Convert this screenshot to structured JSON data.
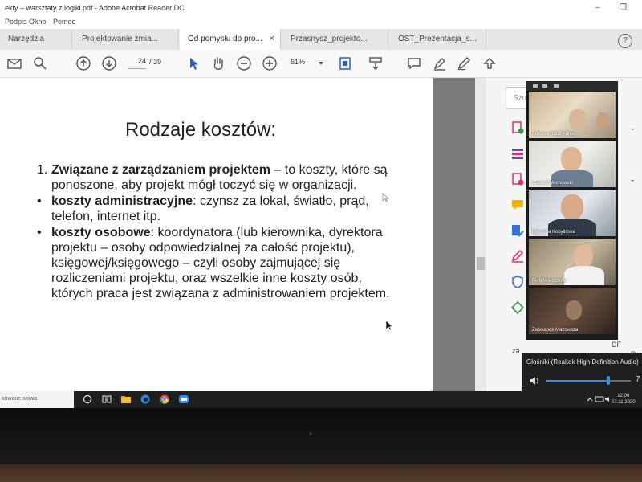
{
  "window": {
    "title": "ekty – warsztaty z logiki.pdf - Adobe Acrobat Reader DC",
    "minimize_icon": "minimize-icon",
    "maximize_icon": "maximize-icon"
  },
  "menu": [
    "Podpis",
    "Okno",
    "Pomoc"
  ],
  "tabs": [
    {
      "label": "Narzędzia",
      "active": false,
      "closable": false
    },
    {
      "label": "Projektowanie zmia...",
      "active": false,
      "closable": false
    },
    {
      "label": "Od pomysłu do pro...",
      "active": true,
      "closable": true
    },
    {
      "label": "Przasnysz_projekto...",
      "active": false,
      "closable": false
    },
    {
      "label": "OST_Prezentacja_s...",
      "active": false,
      "closable": false
    }
  ],
  "toolbar": {
    "page_current": "24",
    "page_total": "/ 39",
    "zoom": "61%",
    "icons": [
      "mail-icon",
      "search-icon",
      "page-up-icon",
      "page-down-icon",
      "select-arrow-icon",
      "hand-icon",
      "zoom-out-icon",
      "zoom-in-icon",
      "zoom-dropdown-icon",
      "fit-page-icon",
      "scroll-mode-icon",
      "comment-icon",
      "highlight-pen-icon",
      "sign-pen-icon",
      "share-icon"
    ]
  },
  "slide": {
    "title": "Rodzaje kosztów:",
    "items": [
      {
        "marker": "1.",
        "bold": "Związane z zarządzaniem projektem",
        "text": " – to koszty, które są ponoszone, aby projekt mógł toczyć się w organizacji."
      },
      {
        "marker": "•",
        "bold": "koszty administracyjne",
        "text": ": czynsz za lokal, światło, prąd, telefon, internet itp."
      },
      {
        "marker": "•",
        "bold": "koszty osobowe",
        "text": ": koordynatora (lub kierownika, dyrektora projektu – osoby odpowiedzialnej za całość projektu), księgowej/księgowego – czyli osoby zajmującej się rozliczeniami projektu, oraz wszelkie inne koszty osób, których praca jest związana z administrowaniem projektem."
      }
    ]
  },
  "right_panel": {
    "search_placeholder": "Szuk",
    "bottom_text_1": "za",
    "bottom_text_2": "DF",
    "bottom_text_3": "Pro DC"
  },
  "participants": [
    {
      "name": "Adriana Rafał Agnie..."
    },
    {
      "name": "Łukasz Wachowski"
    },
    {
      "name": "Marzena Kobylińska"
    },
    {
      "name": "Piotr Wieczorek"
    },
    {
      "name": "Zaścianek Mazowsza"
    }
  ],
  "volume": {
    "label": "Głośniki (Realtek High Definition Audio)",
    "level": 0.74,
    "value_text": "7"
  },
  "taskbar": {
    "search_placeholder": "kowane słowa",
    "time": "12:06",
    "date": "07.11.2020"
  }
}
